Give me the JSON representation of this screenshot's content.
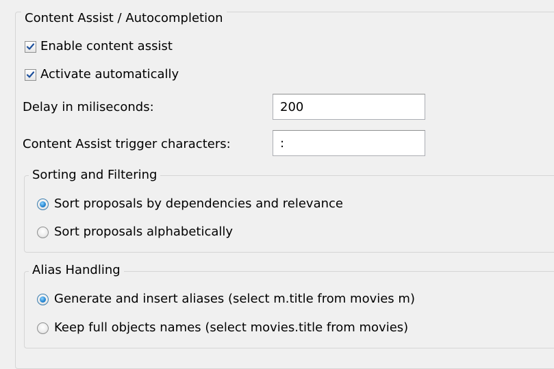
{
  "content_assist": {
    "title": "Content Assist / Autocompletion",
    "enable_label": "Enable content assist",
    "enable_checked": true,
    "activate_label": "Activate automatically",
    "activate_checked": true,
    "delay_label": "Delay in miliseconds:",
    "delay_value": "200",
    "trigger_label": "Content Assist trigger characters:",
    "trigger_value": ":"
  },
  "sorting": {
    "title": "Sorting and Filtering",
    "options": [
      {
        "label": "Sort proposals by dependencies and relevance",
        "selected": true
      },
      {
        "label": "Sort proposals alphabetically",
        "selected": false
      }
    ]
  },
  "alias": {
    "title": "Alias Handling",
    "options": [
      {
        "label": "Generate and insert aliases (select m.title from movies m)",
        "selected": true
      },
      {
        "label": "Keep full objects names (select movies.title from movies)",
        "selected": false
      }
    ]
  },
  "colors": {
    "background": "#f0f0f0",
    "group_border": "#d5d5d5",
    "check_blue": "#1c4f9c",
    "radio_blue": "#2a8ad4"
  }
}
